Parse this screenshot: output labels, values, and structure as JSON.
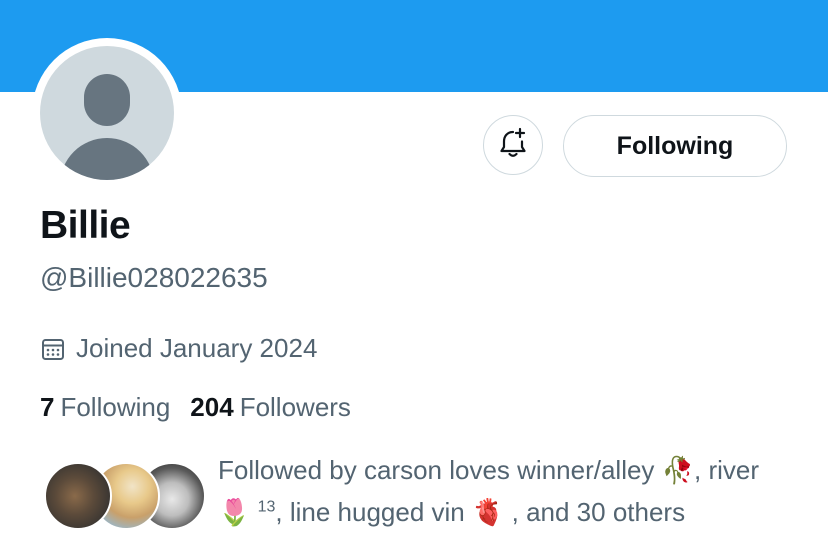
{
  "colors": {
    "banner": "#1d9bf0",
    "text_primary": "#0f1419",
    "text_secondary": "#536471",
    "border": "#cfd9de"
  },
  "profile": {
    "name": "Billie",
    "handle": "@Billie028022635",
    "joined": "Joined January 2024",
    "following_count": "7",
    "following_label": "Following",
    "followers_count": "204",
    "followers_label": "Followers"
  },
  "actions": {
    "notify_icon": "bell-plus-icon",
    "follow_button_label": "Following"
  },
  "followed_by": {
    "prefix": "Followed by carson loves winner/alley",
    "emoji1": "🥀",
    "line2_start": ", river",
    "emoji2": "🌷",
    "sup": "13",
    "mid": ", line hugged vin",
    "emoji3": "🫀",
    "suffix": ", and 30 others"
  }
}
